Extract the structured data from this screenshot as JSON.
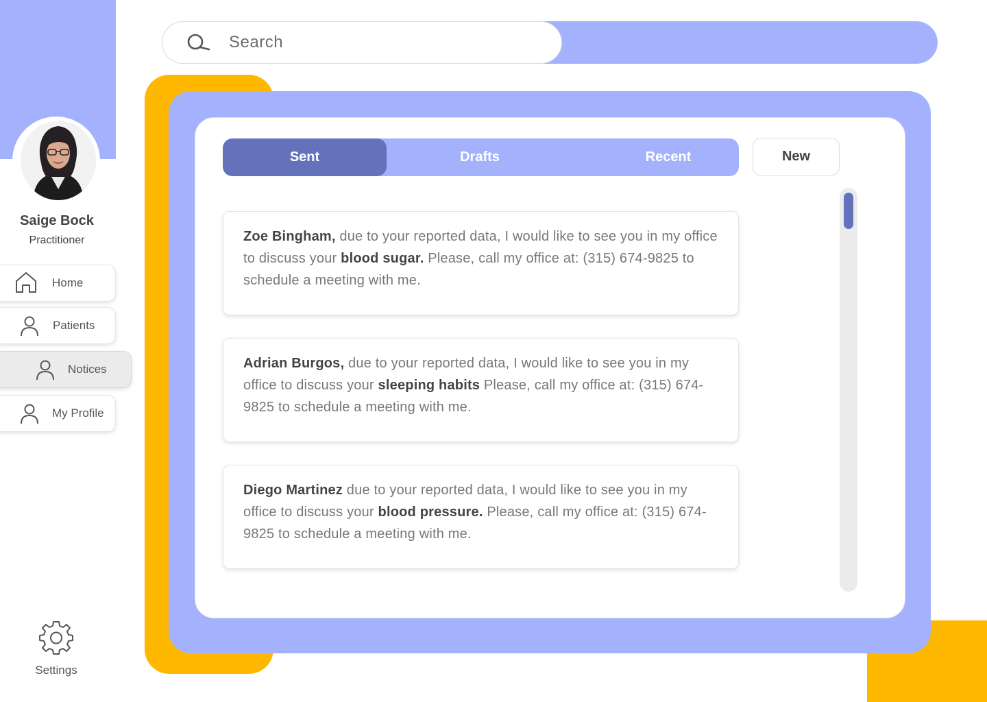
{
  "search": {
    "placeholder": "Search"
  },
  "profile": {
    "name": "Saige Bock",
    "role": "Practitioner"
  },
  "nav": {
    "items": [
      {
        "label": "Home"
      },
      {
        "label": "Patients"
      },
      {
        "label": "Notices"
      },
      {
        "label": "My Profile"
      }
    ],
    "active": "Notices"
  },
  "settings": {
    "label": "Settings"
  },
  "tabs": [
    {
      "label": "Sent"
    },
    {
      "label": "Drafts"
    },
    {
      "label": "Recent"
    }
  ],
  "active_tab": "Sent",
  "new_button": {
    "label": "New"
  },
  "notices": [
    {
      "name": "Zoe Bingham,",
      "text_before": " due to your reported data, I would like to see you in my office to discuss your ",
      "topic": "blood sugar.",
      "text_after": "  Please, call my office at: (315) 674-9825 to schedule a meeting with me."
    },
    {
      "name": "Adrian Burgos,",
      "text_before": " due to your reported data, I would like to see you in my office to discuss your ",
      "topic": "sleeping habits",
      "text_after": "  Please, call my office at: (315) 674-9825 to schedule a meeting with me."
    },
    {
      "name": "Diego Martinez",
      "text_before": "  due to your reported data, I would like to see you in my office to discuss your ",
      "topic": "blood pressure.",
      "text_after": "  Please, call my office at: (315) 674-9825 to schedule a meeting with me."
    }
  ],
  "colors": {
    "accent_lavender": "#a4b2fd",
    "accent_indigo": "#6472bb",
    "accent_yellow": "#ffb800"
  },
  "icons": [
    "search-icon",
    "home-icon",
    "user-icon",
    "gear-icon"
  ]
}
